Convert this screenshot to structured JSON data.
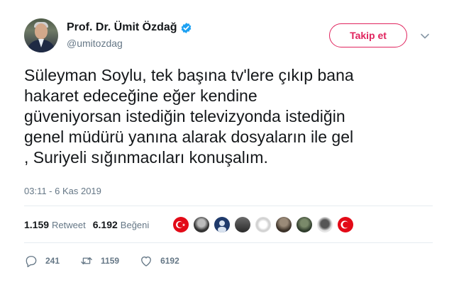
{
  "author": {
    "display_name": "Prof. Dr. Ümit Özdağ",
    "handle": "@umitozdag",
    "verified": true
  },
  "follow_button": {
    "label": "Takip et"
  },
  "tweet": {
    "text": "Süleyman Soylu, tek başına tv'lere çıkıp bana\nhakaret edeceğine  eğer kendine\ngüveniyorsan istediğin televizyonda istediğin\ngenel müdürü yanına alarak dosyaların ile gel\n, Suriyeli sığınmacıları konuşalım.",
    "timestamp": "03:11 - 6 Kas 2019"
  },
  "stats": {
    "retweet_count": "1.159",
    "retweet_label": "Retweet",
    "like_count": "6.192",
    "like_label": "Beğeni"
  },
  "actions": {
    "reply_count": "241",
    "retweet_count": "1159",
    "like_count": "6192"
  },
  "colors": {
    "accent": "#e0245e",
    "verified": "#1da1f2",
    "muted": "#657786"
  },
  "icons": [
    "verified-badge-icon",
    "chevron-down-icon",
    "reply-icon",
    "retweet-icon",
    "heart-icon"
  ]
}
